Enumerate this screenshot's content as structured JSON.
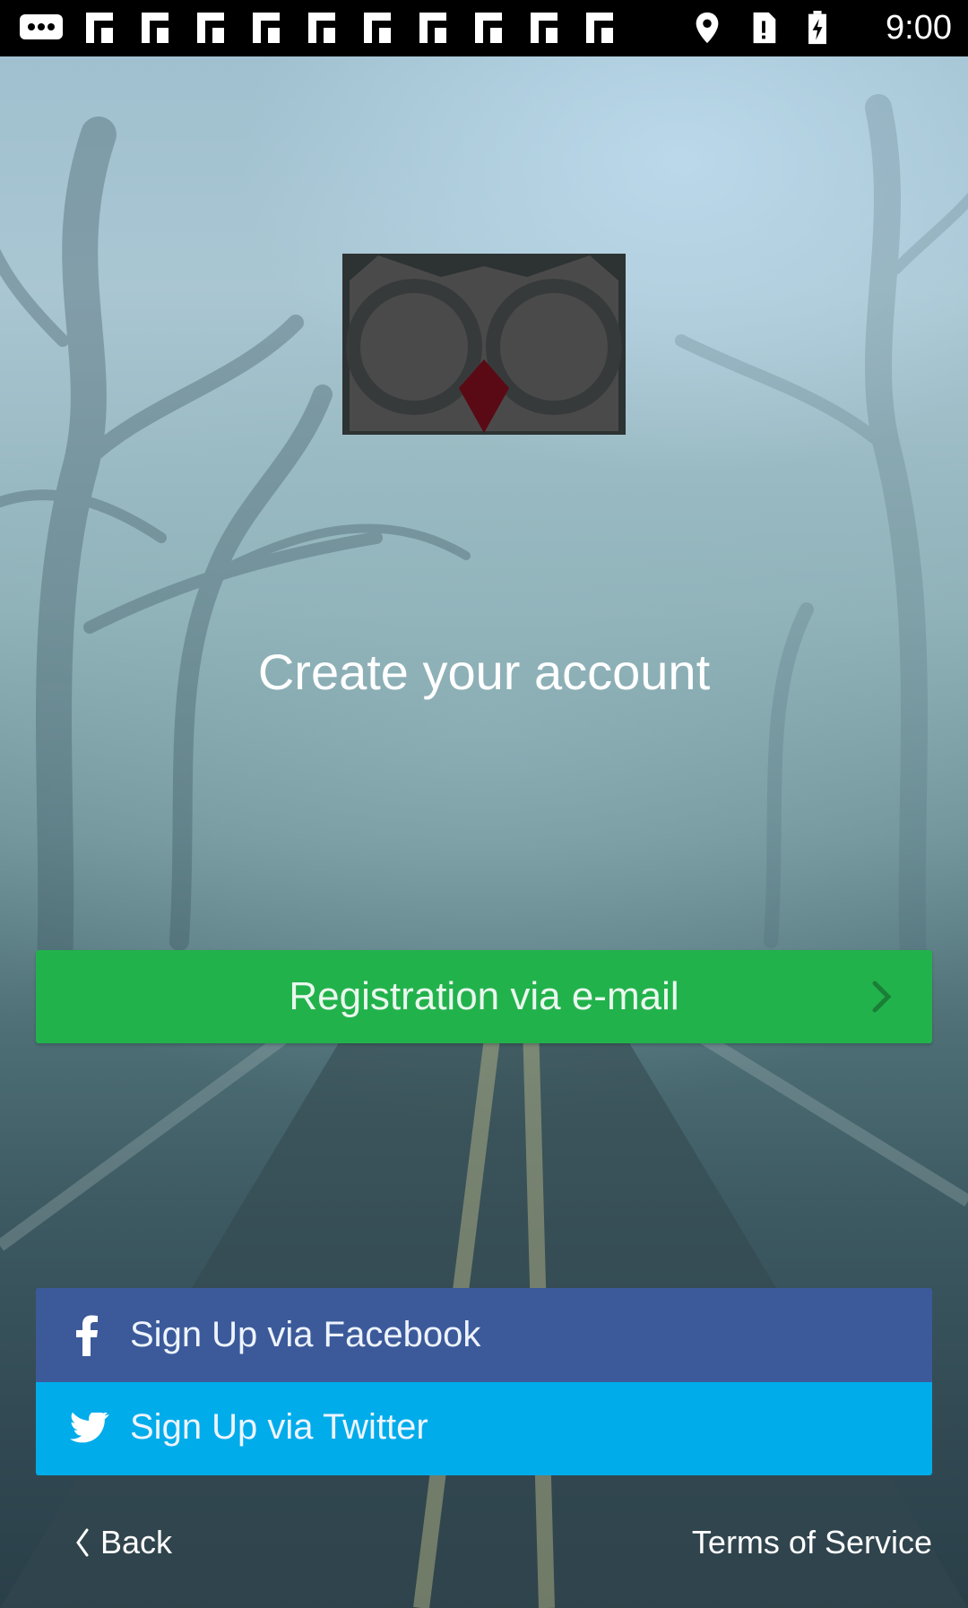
{
  "status_bar": {
    "time": "9:00",
    "icons": [
      "message-notification-icon",
      "flipboard-icon",
      "flipboard-icon",
      "flipboard-icon",
      "flipboard-icon",
      "flipboard-icon",
      "flipboard-icon",
      "flipboard-icon",
      "flipboard-icon",
      "flipboard-icon",
      "flipboard-icon",
      "location-icon",
      "no-sim-icon",
      "battery-charging-icon"
    ]
  },
  "logo": {
    "icon": "owl-logo-icon",
    "colors": {
      "face": "#4a4a4a",
      "beak": "#5a0a14",
      "background": "#2d3233"
    }
  },
  "main": {
    "title": "Create your account",
    "email_button_label": "Registration via e-mail"
  },
  "social": {
    "facebook_label": "Sign Up via Facebook",
    "twitter_label": "Sign Up via Twitter"
  },
  "footer": {
    "back_label": "Back",
    "terms_label": "Terms of Service"
  },
  "colors": {
    "email_button": "#22b24c",
    "facebook_button": "#3c5a9a",
    "twitter_button": "#00acea",
    "status_bar": "#000000"
  }
}
